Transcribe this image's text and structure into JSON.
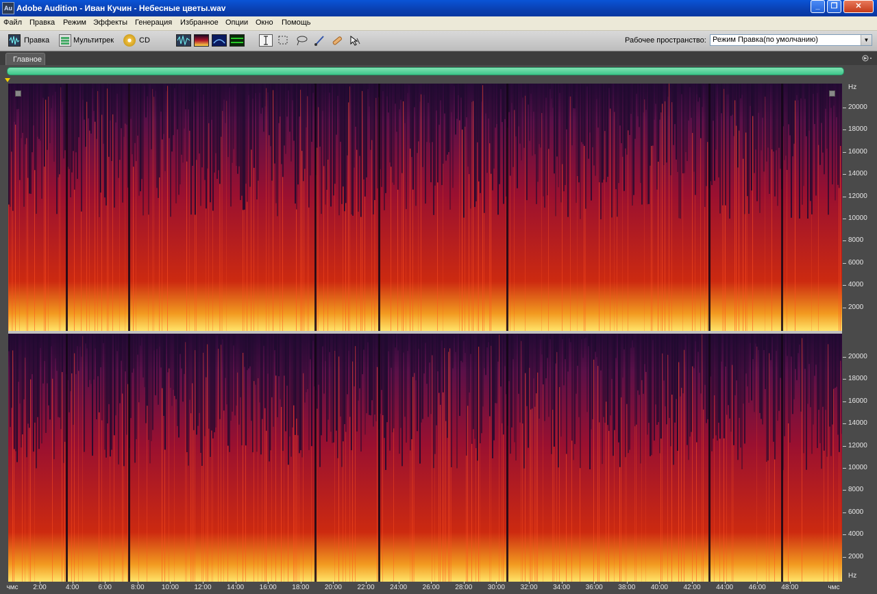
{
  "window": {
    "title": "Adobe Audition - Иван Кучин - Небесные цветы.wav",
    "app_icon_label": "Au"
  },
  "menu": [
    "Файл",
    "Правка",
    "Режим",
    "Эффекты",
    "Генерация",
    "Избранное",
    "Опции",
    "Окно",
    "Помощь"
  ],
  "toolbar": {
    "edit_label": "Правка",
    "multitrack_label": "Мультитрек",
    "cd_label": "CD",
    "workspace_label": "Рабочее пространство:",
    "workspace_value": "Режим Правка(по умолчанию)"
  },
  "panel": {
    "tab_label": "Главное"
  },
  "hz_scale": {
    "unit": "Hz",
    "ticks": [
      "20000",
      "18000",
      "16000",
      "14000",
      "12000",
      "10000",
      "8000",
      "6000",
      "4000",
      "2000"
    ]
  },
  "time_ruler": {
    "start_label": "чмс",
    "end_label": "чмс",
    "ticks": [
      "2:00",
      "4:00",
      "6:00",
      "8:00",
      "10:00",
      "12:00",
      "14:00",
      "16:00",
      "18:00",
      "20:00",
      "22:00",
      "24:00",
      "26:00",
      "28:00",
      "30:00",
      "32:00",
      "34:00",
      "36:00",
      "38:00",
      "40:00",
      "42:00",
      "44:00",
      "46:00",
      "48:00"
    ]
  },
  "colors": {
    "spectrogram_low": "#1a0a26",
    "spectrogram_mid": "#b0152a",
    "spectrogram_high": "#ffd84a",
    "overview_bar": "#5fd6a0",
    "title_bar": "#0a54d6"
  }
}
